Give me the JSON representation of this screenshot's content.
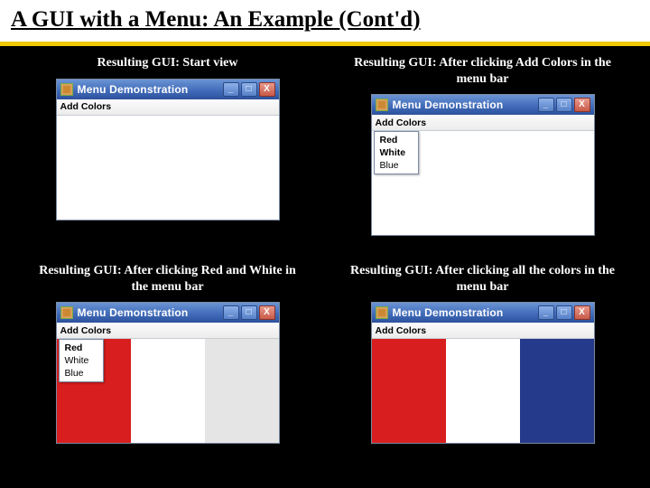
{
  "slide": {
    "title": "A GUI with a Menu: An Example (Cont'd)"
  },
  "window_title": "Menu Demonstration",
  "menubar_label": "Add Colors",
  "win_icons": {
    "min": "_",
    "max": "□",
    "close": "X"
  },
  "menu_items": {
    "red": "Red",
    "white": "White",
    "blue": "Blue"
  },
  "panels": {
    "start": {
      "caption": "Resulting GUI: Start view"
    },
    "menu_open": {
      "caption": "Resulting GUI: After clicking Add Colors in the menu bar"
    },
    "red_white": {
      "caption": "Resulting GUI: After clicking Red and White in the menu bar"
    },
    "all": {
      "caption": "Resulting GUI: After clicking all the colors in the menu bar"
    }
  }
}
